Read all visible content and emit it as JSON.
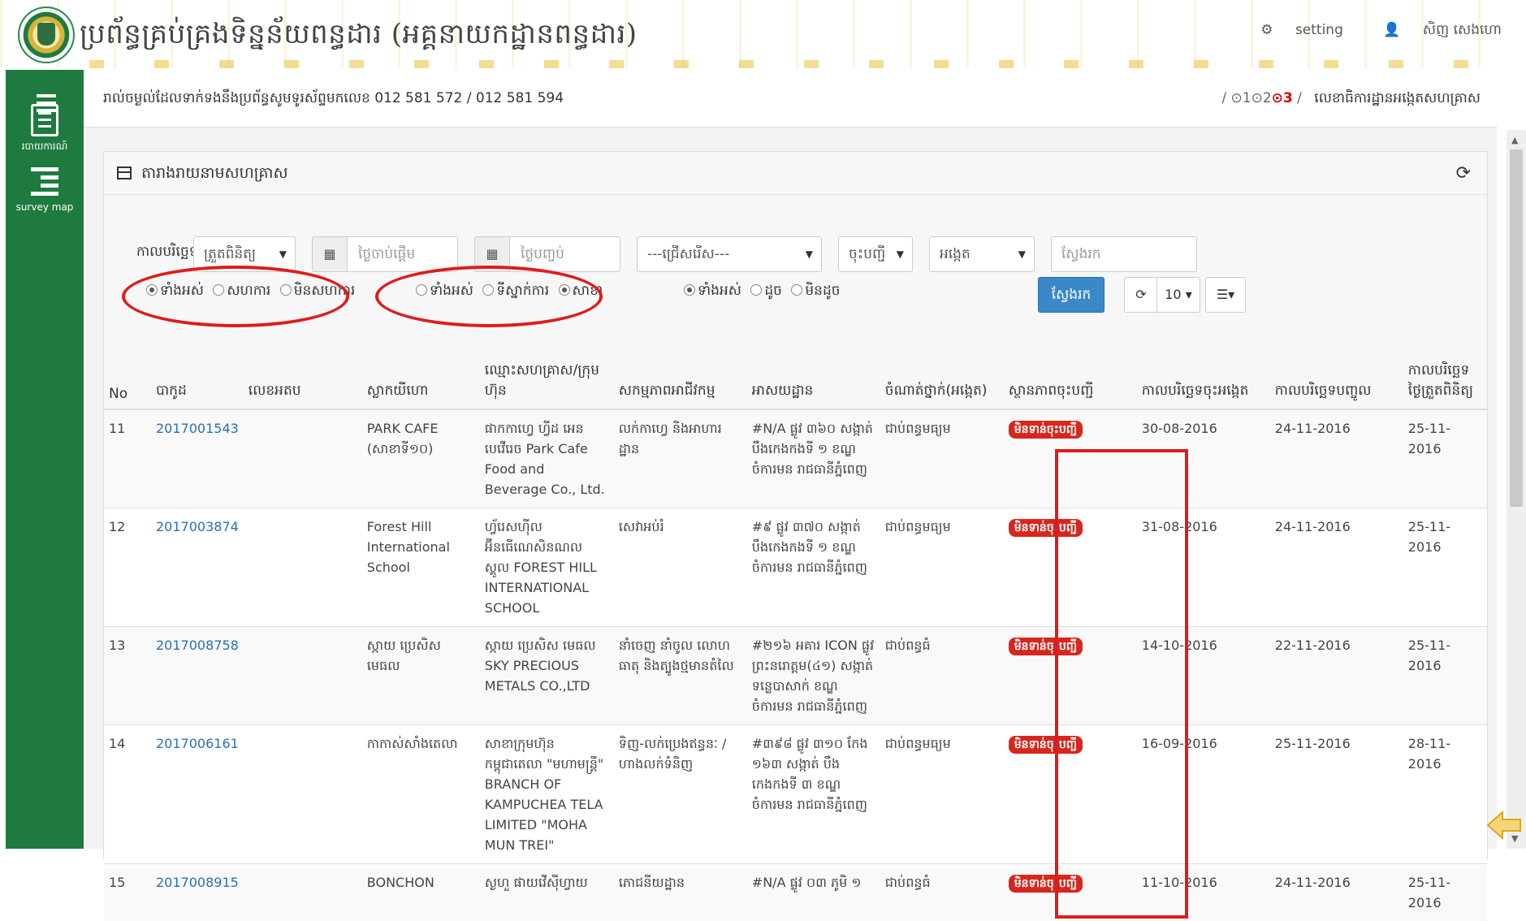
{
  "header": {
    "title": "ប្រព័ន្ធគ្រប់គ្រងទិន្នន័យពន្ធដារ (អគ្គនាយកដ្ឋានពន្ធដារ)",
    "setting_label": "setting",
    "user_label": "សិញ សេងហោ"
  },
  "sidebar": {
    "items": [
      {
        "label": "របាយការណ៍",
        "icon": "list-icon"
      },
      {
        "label": "survey map",
        "icon": "indent-icon"
      }
    ]
  },
  "infobar": {
    "text": "រាល់ចម្ងល់ដែលទាក់ទងនឹងប្រព័ន្ធសូមទូរស័ព្ទមកលេខ 012 581 572 / 012 581 594",
    "steps_prefix": "/ ⊙1⊙2",
    "steps_active": "⊙3",
    "steps_suffix": "/",
    "breadcrumb": "លេខាធិការដ្ឋានអង្កេតសហគ្រាស"
  },
  "panel": {
    "title": "តារាងរាយនាមសហគ្រាស"
  },
  "filters": {
    "date_label": "កាលបរិច្ឆេទ :",
    "date_type": "ត្រួតពិនិត្យ",
    "start_placeholder": "ថ្ងៃចាប់ផ្តើម",
    "end_placeholder": "ថ្ងៃបញ្ចប់",
    "select_label": "---ជ្រើសរើស---",
    "register_select": "ចុះបញ្ជី",
    "survey_select": "អង្កេត",
    "search_placeholder": "ស្វែងរក",
    "group1": [
      "ទាំងអស់",
      "សហការ",
      "មិនសហការ"
    ],
    "group2": [
      "ទាំងអស់",
      "ទីស្នាក់ការ",
      "សាខា"
    ],
    "group3": [
      "ទាំងអស់",
      "ដូច",
      "មិនដូច"
    ],
    "search_button": "ស្វែងរក",
    "page_size": "10 ▾"
  },
  "table": {
    "headers": [
      "No",
      "បាកូដ",
      "លេខអតប",
      "ស្លាកយីហោ",
      "ឈ្មោះសហគ្រាស/ក្រុមហ៊ុន",
      "សកម្មភាពអាជីវកម្ម",
      "អាសយដ្ឋាន",
      "ចំណាត់ថ្នាក់(អង្កេត)",
      "ស្ថានភាពចុះបញ្ជី",
      "កាលបរិច្ឆេទចុះអង្កេត",
      "កាលបរិច្ឆេទបញ្ចូល",
      "កាលបរិច្ឆេទថ្ងៃត្រួតពិនិត្យ"
    ],
    "rows": [
      {
        "no": "11",
        "code": "2017001543",
        "tin": "",
        "brand": "PARK CAFE (សាខាទី១០)",
        "company": "ផាកកាហ្វេ ហ្វីដ អេន បេវើរេច Park Cafe Food and Beverage Co., Ltd.",
        "activity": "លក់កាហ្វេ និងអាហារដ្ឋាន",
        "address": "#N/A ផ្លូវ ៣៦០ សង្កាត់ បឹងកេងកងទី ១ ខណ្ឌ ចំការមន រាជធានីភ្នំពេញ",
        "class": "ជាប់ពន្ធមធ្យម",
        "status": "មិនទាន់ចុះបញ្ជី",
        "survey_date": "30-08-2016",
        "entry_date": "24-11-2016",
        "check_date": "25-11-2016"
      },
      {
        "no": "12",
        "code": "2017003874",
        "tin": "",
        "brand": "Forest Hill International School",
        "company": "ហ្វ័រេសហ៊ីល អ៊ីនធើណេសិនណល ស្គូល FOREST HILL INTERNATIONAL SCHOOL",
        "activity": "សេវាអប់រំ",
        "address": "#៩ ផ្លូវ ៣៧០ សង្កាត់ បឹងកេងកងទី ១ ខណ្ឌ ចំការមន រាជធានីភ្នំពេញ",
        "class": "ជាប់ពន្ធមធ្យម",
        "status": "មិនទាន់ចុះបញ្ជី",
        "survey_date": "31-08-2016",
        "entry_date": "24-11-2016",
        "check_date": "25-11-2016"
      },
      {
        "no": "13",
        "code": "2017008758",
        "tin": "",
        "brand": "ស្កាយ ប្រេសិស មេធល",
        "company": "ស្កាយ ប្រេសិស មេធល SKY PRECIOUS METALS CO.,LTD",
        "activity": "នាំចេញ នាំចូល លោហធាតុ និងត្បូងថ្មមានតំលៃ",
        "address": "#២១៦ អគារ ICON ផ្លូវ ព្រះនរោត្តម(៤១) សង្កាត់ ទន្លេបាសាក់ ខណ្ឌ ចំការមន រាជធានីភ្នំពេញ",
        "class": "ជាប់ពន្ធធំ",
        "status": "មិនទាន់ចុះបញ្ជី",
        "survey_date": "14-10-2016",
        "entry_date": "22-11-2016",
        "check_date": "25-11-2016"
      },
      {
        "no": "14",
        "code": "2017006161",
        "tin": "",
        "brand": "កាកាស់សាំងតេលា",
        "company": "សាខាក្រុមហ៊ុន កម្ពុជាតេលា \"មហាមន្ត្រី\" BRANCH OF KAMPUCHEA TELA LIMITED \"MOHA MUN TREI\"",
        "activity": "ទិញ-លក់ប្រេងឥន្ធនៈ / ហាងលក់ទំនិញ",
        "address": "#៣៩៨ ផ្លូវ ៣១០ កែង ១៦៣ សង្កាត់ បឹងកេងកងទី ៣ ខណ្ឌ ចំការមន រាជធានីភ្នំពេញ",
        "class": "ជាប់ពន្ធមធ្យម",
        "status": "មិនទាន់ចុះបញ្ជី",
        "survey_date": "16-09-2016",
        "entry_date": "25-11-2016",
        "check_date": "28-11-2016"
      },
      {
        "no": "15",
        "code": "2017008915",
        "tin": "",
        "brand": "BONCHON",
        "company": "ស្ងហួ ផាយវើស៊ីហ្វាយ",
        "activity": "ភោជនីយដ្ឋាន",
        "address": "#N/A ផ្លូវ ០៣ ភូមិ ១",
        "class": "ជាប់ពន្ធធំ",
        "status": "មិនទាន់ចុះបញ្ជី",
        "survey_date": "11-10-2016",
        "entry_date": "24-11-2016",
        "check_date": "25-11-2016"
      }
    ]
  },
  "colors": {
    "sidebar": "#1f7a3f",
    "primary_button": "#3a87c9",
    "status_badge": "#d7261e",
    "annotation": "#e01b1b",
    "link": "#2a6fb5"
  }
}
